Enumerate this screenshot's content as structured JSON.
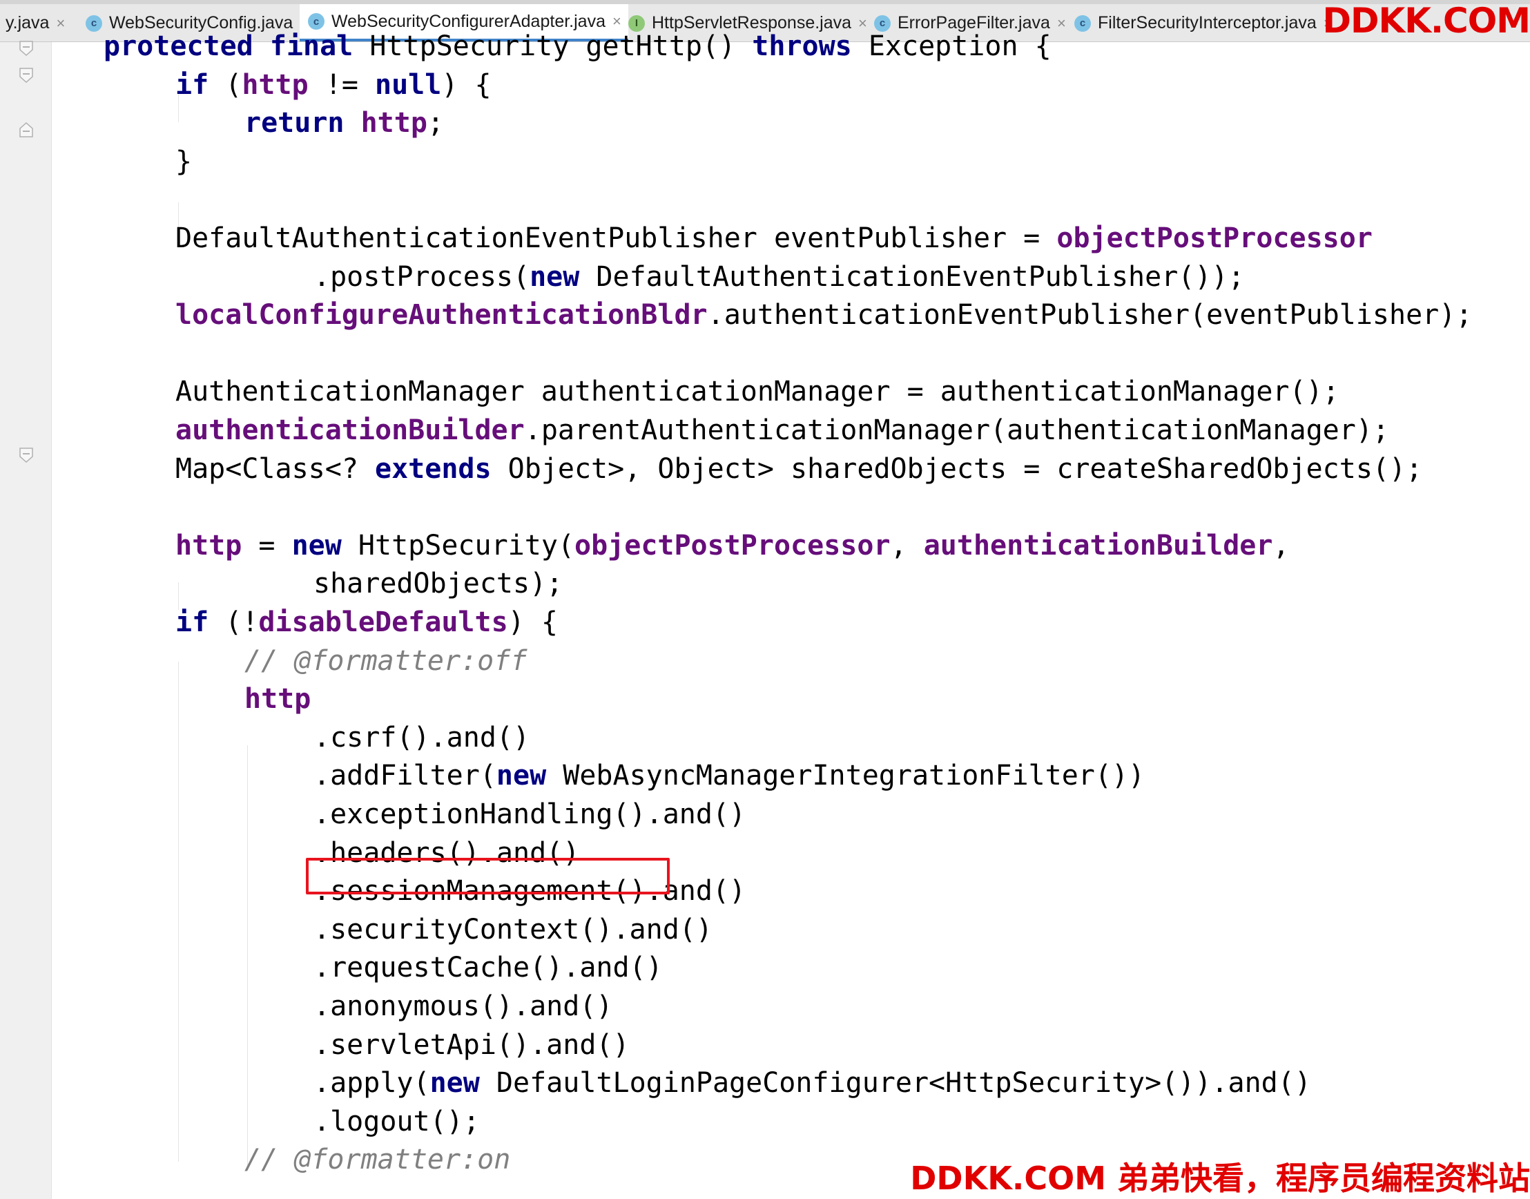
{
  "tabs": [
    {
      "label": "y.java",
      "icon": "none",
      "active": false
    },
    {
      "label": "WebSecurityConfig.java",
      "icon": "class-icon",
      "active": false
    },
    {
      "label": "WebSecurityConfigurerAdapter.java",
      "icon": "class-icon",
      "active": true
    },
    {
      "label": "HttpServletResponse.java",
      "icon": "interface-icon",
      "active": false
    },
    {
      "label": "ErrorPageFilter.java",
      "icon": "class-icon",
      "active": false
    },
    {
      "label": "FilterSecurityInterceptor.java",
      "icon": "class-icon",
      "active": false
    }
  ],
  "icon_letters": {
    "class": "c",
    "interface": "I"
  },
  "close_glyph": "×",
  "watermark_top": "DDKK.COM",
  "watermark_bottom": "DDKK.COM 弟弟快看，程序员编程资料站",
  "code": {
    "lines": [
      [
        [
          "kw",
          "protected"
        ],
        [
          "t",
          " "
        ],
        [
          "kw",
          "final"
        ],
        [
          "t",
          " HttpSecurity getHttp() "
        ],
        [
          "kw",
          "throws"
        ],
        [
          "t",
          " Exception {"
        ]
      ],
      [
        [
          "kw",
          "if"
        ],
        [
          "t",
          " ("
        ],
        [
          "fld",
          "http"
        ],
        [
          "t",
          " != "
        ],
        [
          "kw",
          "null"
        ],
        [
          "t",
          ") {"
        ]
      ],
      [
        [
          "kw",
          "return"
        ],
        [
          "t",
          " "
        ],
        [
          "fld",
          "http"
        ],
        [
          "t",
          ";"
        ]
      ],
      [
        [
          "t",
          "}"
        ]
      ],
      [],
      [
        [
          "t",
          "DefaultAuthenticationEventPublisher eventPublisher = "
        ],
        [
          "fld",
          "objectPostProcessor"
        ]
      ],
      [
        [
          "t",
          ".postProcess("
        ],
        [
          "kw",
          "new"
        ],
        [
          "t",
          " DefaultAuthenticationEventPublisher());"
        ]
      ],
      [
        [
          "fld",
          "localConfigureAuthenticationBldr"
        ],
        [
          "t",
          ".authenticationEventPublisher(eventPublisher);"
        ]
      ],
      [],
      [
        [
          "t",
          "AuthenticationManager authenticationManager = authenticationManager();"
        ]
      ],
      [
        [
          "fld",
          "authenticationBuilder"
        ],
        [
          "t",
          ".parentAuthenticationManager(authenticationManager);"
        ]
      ],
      [
        [
          "t",
          "Map<Class<? "
        ],
        [
          "kw",
          "extends"
        ],
        [
          "t",
          " Object>, Object> sharedObjects = createSharedObjects();"
        ]
      ],
      [],
      [
        [
          "fld",
          "http"
        ],
        [
          "t",
          " = "
        ],
        [
          "kw",
          "new"
        ],
        [
          "t",
          " HttpSecurity("
        ],
        [
          "fld",
          "objectPostProcessor"
        ],
        [
          "t",
          ", "
        ],
        [
          "fld",
          "authenticationBuilder"
        ],
        [
          "t",
          ","
        ]
      ],
      [
        [
          "t",
          "sharedObjects);"
        ]
      ],
      [
        [
          "kw",
          "if"
        ],
        [
          "t",
          " (!"
        ],
        [
          "fld",
          "disableDefaults"
        ],
        [
          "t",
          ") {"
        ]
      ],
      [
        [
          "cmt",
          "// @formatter:off"
        ]
      ],
      [
        [
          "fld",
          "http"
        ]
      ],
      [
        [
          "t",
          ".csrf().and()"
        ]
      ],
      [
        [
          "t",
          ".addFilter("
        ],
        [
          "kw",
          "new"
        ],
        [
          "t",
          " WebAsyncManagerIntegrationFilter())"
        ]
      ],
      [
        [
          "t",
          ".exceptionHandling().and()"
        ]
      ],
      [
        [
          "t",
          ".headers().and()"
        ]
      ],
      [
        [
          "t",
          ".sessionManagement().and()"
        ]
      ],
      [
        [
          "t",
          ".securityContext().and()"
        ]
      ],
      [
        [
          "t",
          ".requestCache().and()"
        ]
      ],
      [
        [
          "t",
          ".anonymous().and()"
        ]
      ],
      [
        [
          "t",
          ".servletApi().and()"
        ]
      ],
      [
        [
          "t",
          ".apply("
        ],
        [
          "kw",
          "new"
        ],
        [
          "t",
          " DefaultLoginPageConfigurer<HttpSecurity>()).and()"
        ]
      ],
      [
        [
          "t",
          ".logout();"
        ]
      ],
      [
        [
          "cmt",
          "// @formatter:on"
        ]
      ]
    ]
  },
  "colors": {
    "keyword": "#000080",
    "field": "#660e7a",
    "comment": "#808080",
    "highlight_box": "#e8141e",
    "watermark": "#e10000",
    "active_tab_underline": "#4083c9"
  }
}
